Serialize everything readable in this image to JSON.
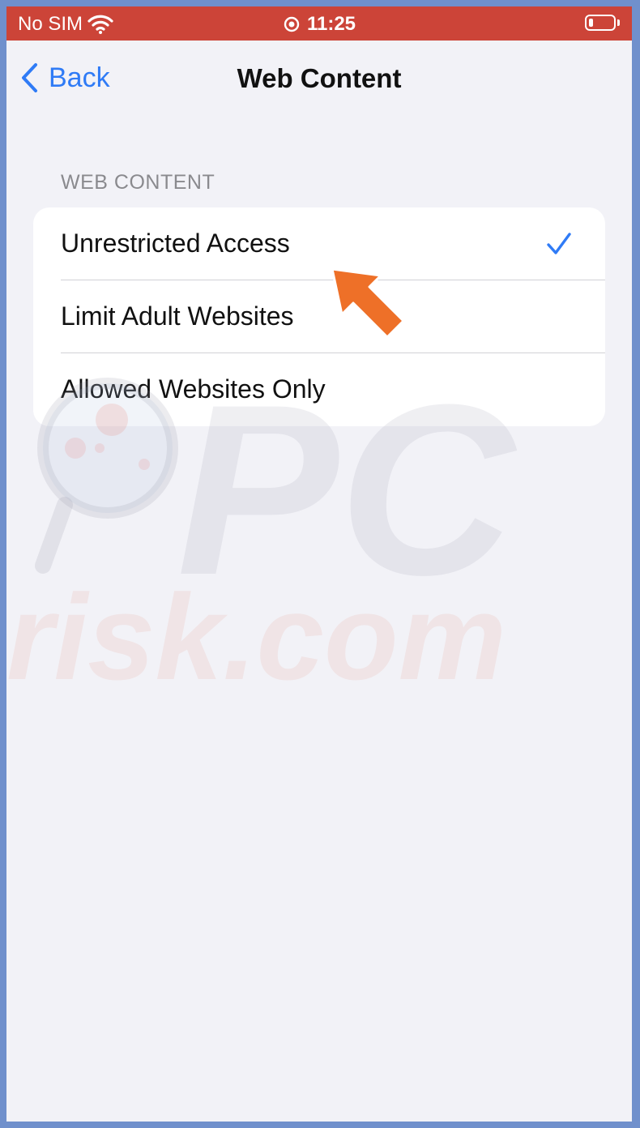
{
  "status_bar": {
    "carrier": "No SIM",
    "time": "11:25",
    "icons": [
      "wifi-icon",
      "location-icon",
      "battery-icon"
    ],
    "color": "#cc4438"
  },
  "nav": {
    "back_label": "Back",
    "title": "Web Content",
    "accent_color": "#2f7bf6"
  },
  "section": {
    "header": "WEB CONTENT",
    "options": [
      {
        "label": "Unrestricted Access",
        "selected": true
      },
      {
        "label": "Limit Adult Websites",
        "selected": false
      },
      {
        "label": "Allowed Websites Only",
        "selected": false
      }
    ]
  },
  "watermark": {
    "line1": "PC",
    "line2": "risk.com"
  },
  "annotation": {
    "icon": "arrow-icon",
    "color": "#ee7028"
  }
}
